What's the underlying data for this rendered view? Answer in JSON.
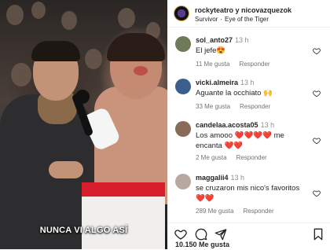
{
  "video": {
    "caption": "NUNCA VI ALGO ASÍ"
  },
  "header": {
    "accounts": "rockyteatro y nicovazquezok",
    "artist": "Survivor",
    "separator": "·",
    "song": "Eye of the Tiger"
  },
  "comments": [
    {
      "user": "sol_anto27",
      "time": "13 h",
      "text": "El jefe😍",
      "likes": "11 Me gusta",
      "reply": "Responder",
      "avatar_color": "#6e7a5a"
    },
    {
      "user": "vicki.almeira",
      "time": "13 h",
      "text": "Aguante la occhiato 🙌",
      "likes": "33 Me gusta",
      "reply": "Responder",
      "avatar_color": "#3a5f8c"
    },
    {
      "user": "candelaa.acosta05",
      "time": "13 h",
      "text": "Los amooo ❤️❤️❤️❤️ me encanta ❤️❤️",
      "likes": "2 Me gusta",
      "reply": "Responder",
      "avatar_color": "#8a6b5a"
    },
    {
      "user": "maggalii4",
      "time": "13 h",
      "text": "se cruzaron mis nico's favoritos ❤️❤️",
      "likes": "289 Me gusta",
      "reply": "Responder",
      "avatar_color": "#b7a9a0"
    }
  ],
  "footer": {
    "likes": "10.150 Me gusta"
  },
  "icons": {
    "like": "heart-outline-icon",
    "comment": "comment-bubble-icon",
    "share": "paper-plane-icon",
    "save": "bookmark-icon",
    "music": "music-note-icon"
  }
}
